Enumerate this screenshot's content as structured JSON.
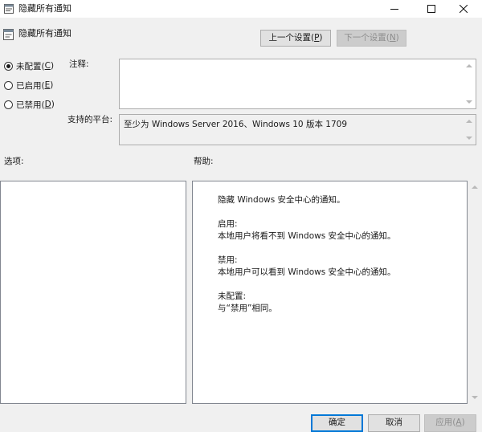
{
  "window": {
    "title": "隐藏所有通知",
    "icons": [
      "policy-icon",
      "minimize-icon",
      "maximize-icon",
      "close-icon"
    ]
  },
  "header": {
    "title": "隐藏所有通知",
    "prev_button": {
      "label": "上一个设置(",
      "key": "P",
      "suffix": ")"
    },
    "next_button": {
      "label": "下一个设置(",
      "key": "N",
      "suffix": ")"
    }
  },
  "state": {
    "options": [
      {
        "label": "未配置(",
        "key": "C",
        "suffix": ")",
        "checked": true
      },
      {
        "label": "已启用(",
        "key": "E",
        "suffix": ")",
        "checked": false
      },
      {
        "label": "已禁用(",
        "key": "D",
        "suffix": ")",
        "checked": false
      }
    ]
  },
  "comment": {
    "label": "注释:",
    "value": ""
  },
  "platform": {
    "label": "支持的平台:",
    "value": "至少为 Windows Server 2016、Windows 10 版本 1709"
  },
  "options_section": {
    "label": "选项:"
  },
  "help_section": {
    "label": "帮助:",
    "paragraphs": [
      [
        "隐藏 Windows 安全中心的通知。"
      ],
      [
        "启用:",
        "本地用户将看不到 Windows 安全中心的通知。"
      ],
      [
        "禁用:",
        "本地用户可以看到 Windows 安全中心的通知。"
      ],
      [
        "未配置:",
        "与“禁用”相同。"
      ]
    ]
  },
  "footer": {
    "ok_label": "确定",
    "cancel_label": "取消",
    "apply": {
      "label": "应用(",
      "key": "A",
      "suffix": ")"
    }
  },
  "colors": {
    "background": "#f0f0f0",
    "focus_border": "#0078d7",
    "disabled_text": "#8d8d8d"
  }
}
